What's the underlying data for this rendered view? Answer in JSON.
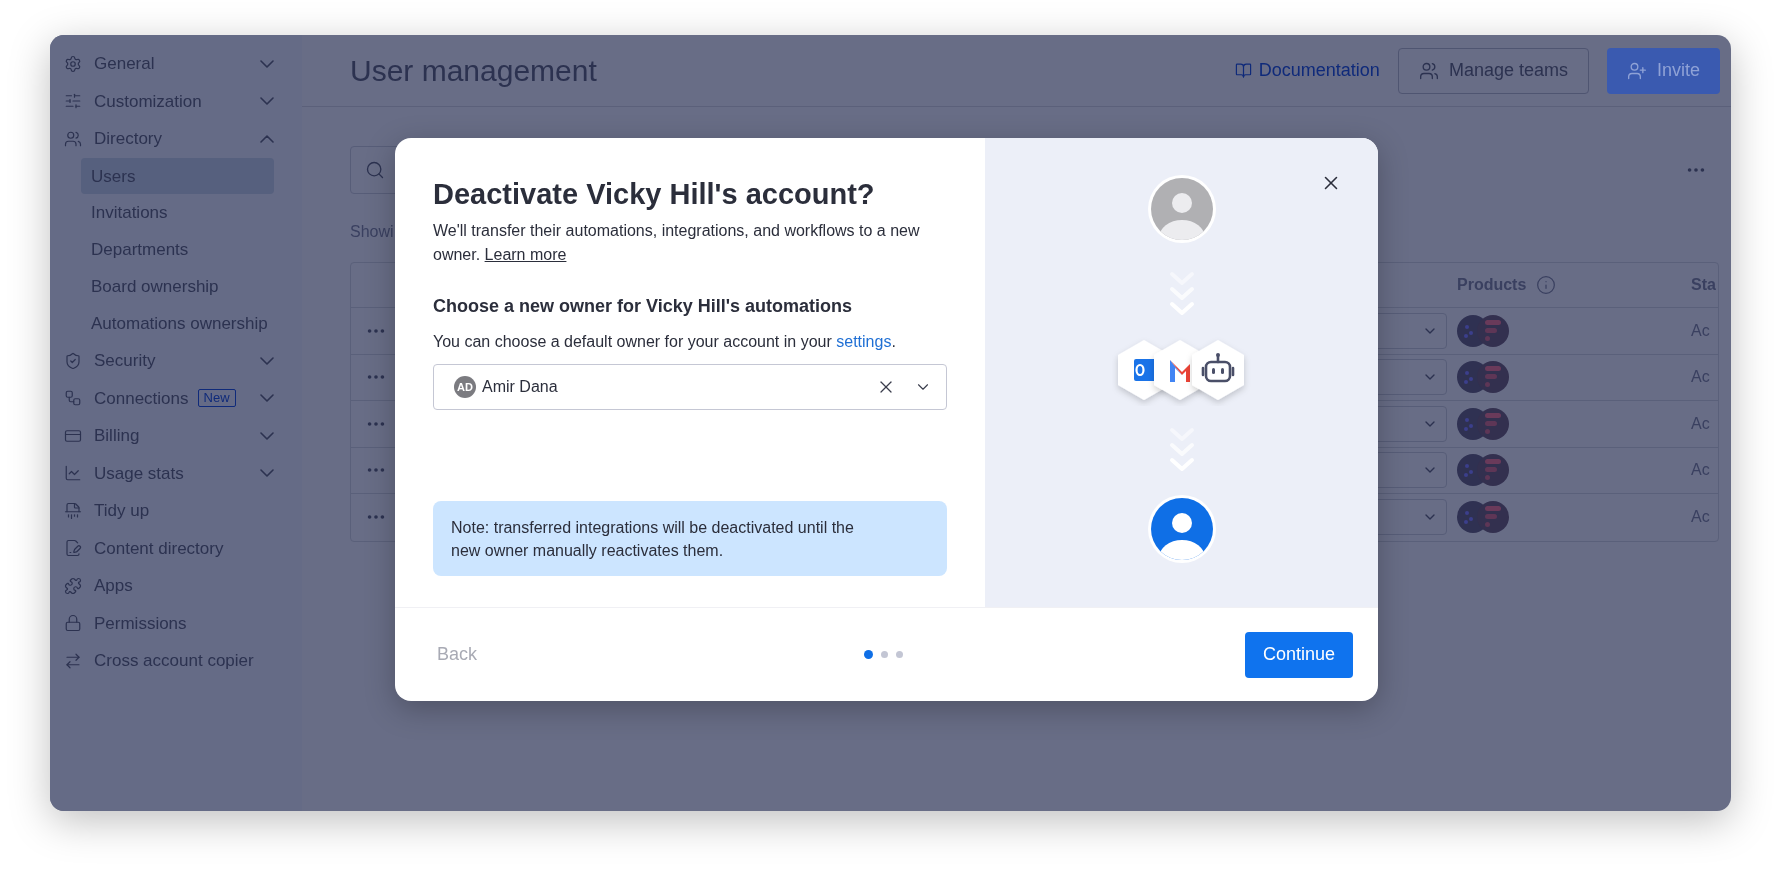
{
  "sidebar": {
    "items": [
      {
        "label": "General",
        "kind": "group",
        "expanded": false
      },
      {
        "label": "Customization",
        "kind": "group",
        "expanded": false
      },
      {
        "label": "Directory",
        "kind": "group",
        "expanded": true,
        "children": [
          {
            "label": "Users",
            "selected": true
          },
          {
            "label": "Invitations",
            "selected": false
          },
          {
            "label": "Departments",
            "selected": false
          },
          {
            "label": "Board ownership",
            "selected": false
          },
          {
            "label": "Automations ownership",
            "selected": false
          }
        ]
      },
      {
        "label": "Security",
        "kind": "group",
        "expanded": false
      },
      {
        "label": "Connections",
        "kind": "group",
        "expanded": false,
        "badge": "New"
      },
      {
        "label": "Billing",
        "kind": "group",
        "expanded": false
      },
      {
        "label": "Usage stats",
        "kind": "group",
        "expanded": false
      },
      {
        "label": "Tidy up",
        "kind": "link"
      },
      {
        "label": "Content directory",
        "kind": "link"
      },
      {
        "label": "Apps",
        "kind": "link"
      },
      {
        "label": "Permissions",
        "kind": "link"
      },
      {
        "label": "Cross account copier",
        "kind": "link"
      }
    ]
  },
  "header": {
    "title": "User management",
    "documentation": "Documentation",
    "manage_teams": "Manage teams",
    "invite": "Invite"
  },
  "list": {
    "showing": "Showi",
    "columns": {
      "products": "Products",
      "status": "Sta"
    },
    "rows": [
      {
        "status": "Ac"
      },
      {
        "status": "Ac"
      },
      {
        "status": "Ac"
      },
      {
        "status": "Ac"
      },
      {
        "status": "Ac"
      }
    ]
  },
  "dialog": {
    "title": "Deactivate Vicky Hill's account?",
    "description": "We'll transfer their automations, integrations, and workflows to a new owner.",
    "learn_more": "Learn more",
    "subheading": "Choose a new owner for Vicky Hill's automations",
    "hint": "You can choose a default owner for your account in your",
    "hint_link": "settings",
    "hint_end": ".",
    "owner": {
      "initials": "AD",
      "name": "Amir Dana"
    },
    "note": "Note: transferred integrations will be deactivated until the new owner manually reactivates them.",
    "back": "Back",
    "steps": [
      {
        "selected": true
      },
      {
        "selected": false
      },
      {
        "selected": false
      }
    ],
    "continue": "Continue"
  }
}
